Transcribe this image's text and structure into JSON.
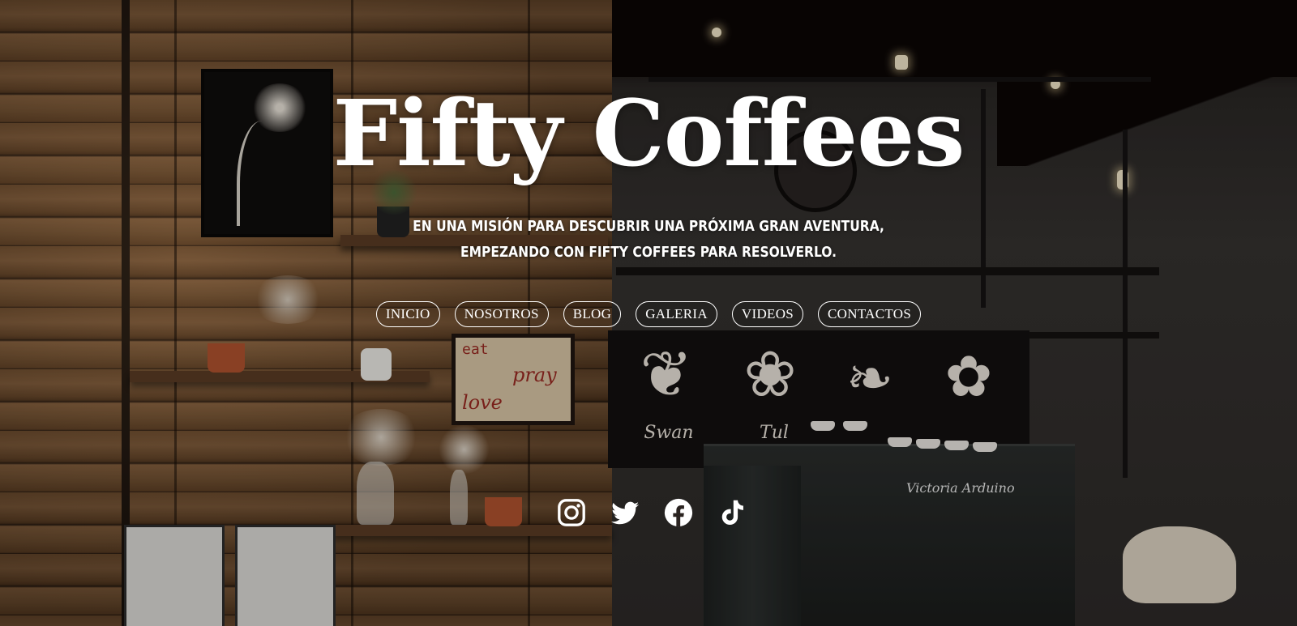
{
  "site": {
    "title": "Fifty Coffees",
    "tagline_line1": "EN UNA MISIÓN PARA DESCUBRIR UNA PRÓXIMA GRAN AVENTURA,",
    "tagline_line2": "EMPEZANDO CON FIFTY COFFEES PARA RESOLVERLO."
  },
  "nav": {
    "items": [
      {
        "label": "INICIO"
      },
      {
        "label": "NOSOTROS"
      },
      {
        "label": "BLOG"
      },
      {
        "label": "GALERIA"
      },
      {
        "label": "VIDEOS"
      },
      {
        "label": "CONTACTOS"
      }
    ]
  },
  "social": {
    "icons": [
      "instagram-icon",
      "twitter-icon",
      "facebook-icon",
      "tiktok-icon"
    ]
  },
  "background": {
    "chalk_labels": [
      "Swan",
      "Tul"
    ],
    "sign_words": [
      "eat",
      "pray",
      "love"
    ],
    "machine_brand": "Victoria Arduino"
  },
  "colors": {
    "text": "#ffffff",
    "wood": "#7a5533",
    "wall": "#353230"
  }
}
